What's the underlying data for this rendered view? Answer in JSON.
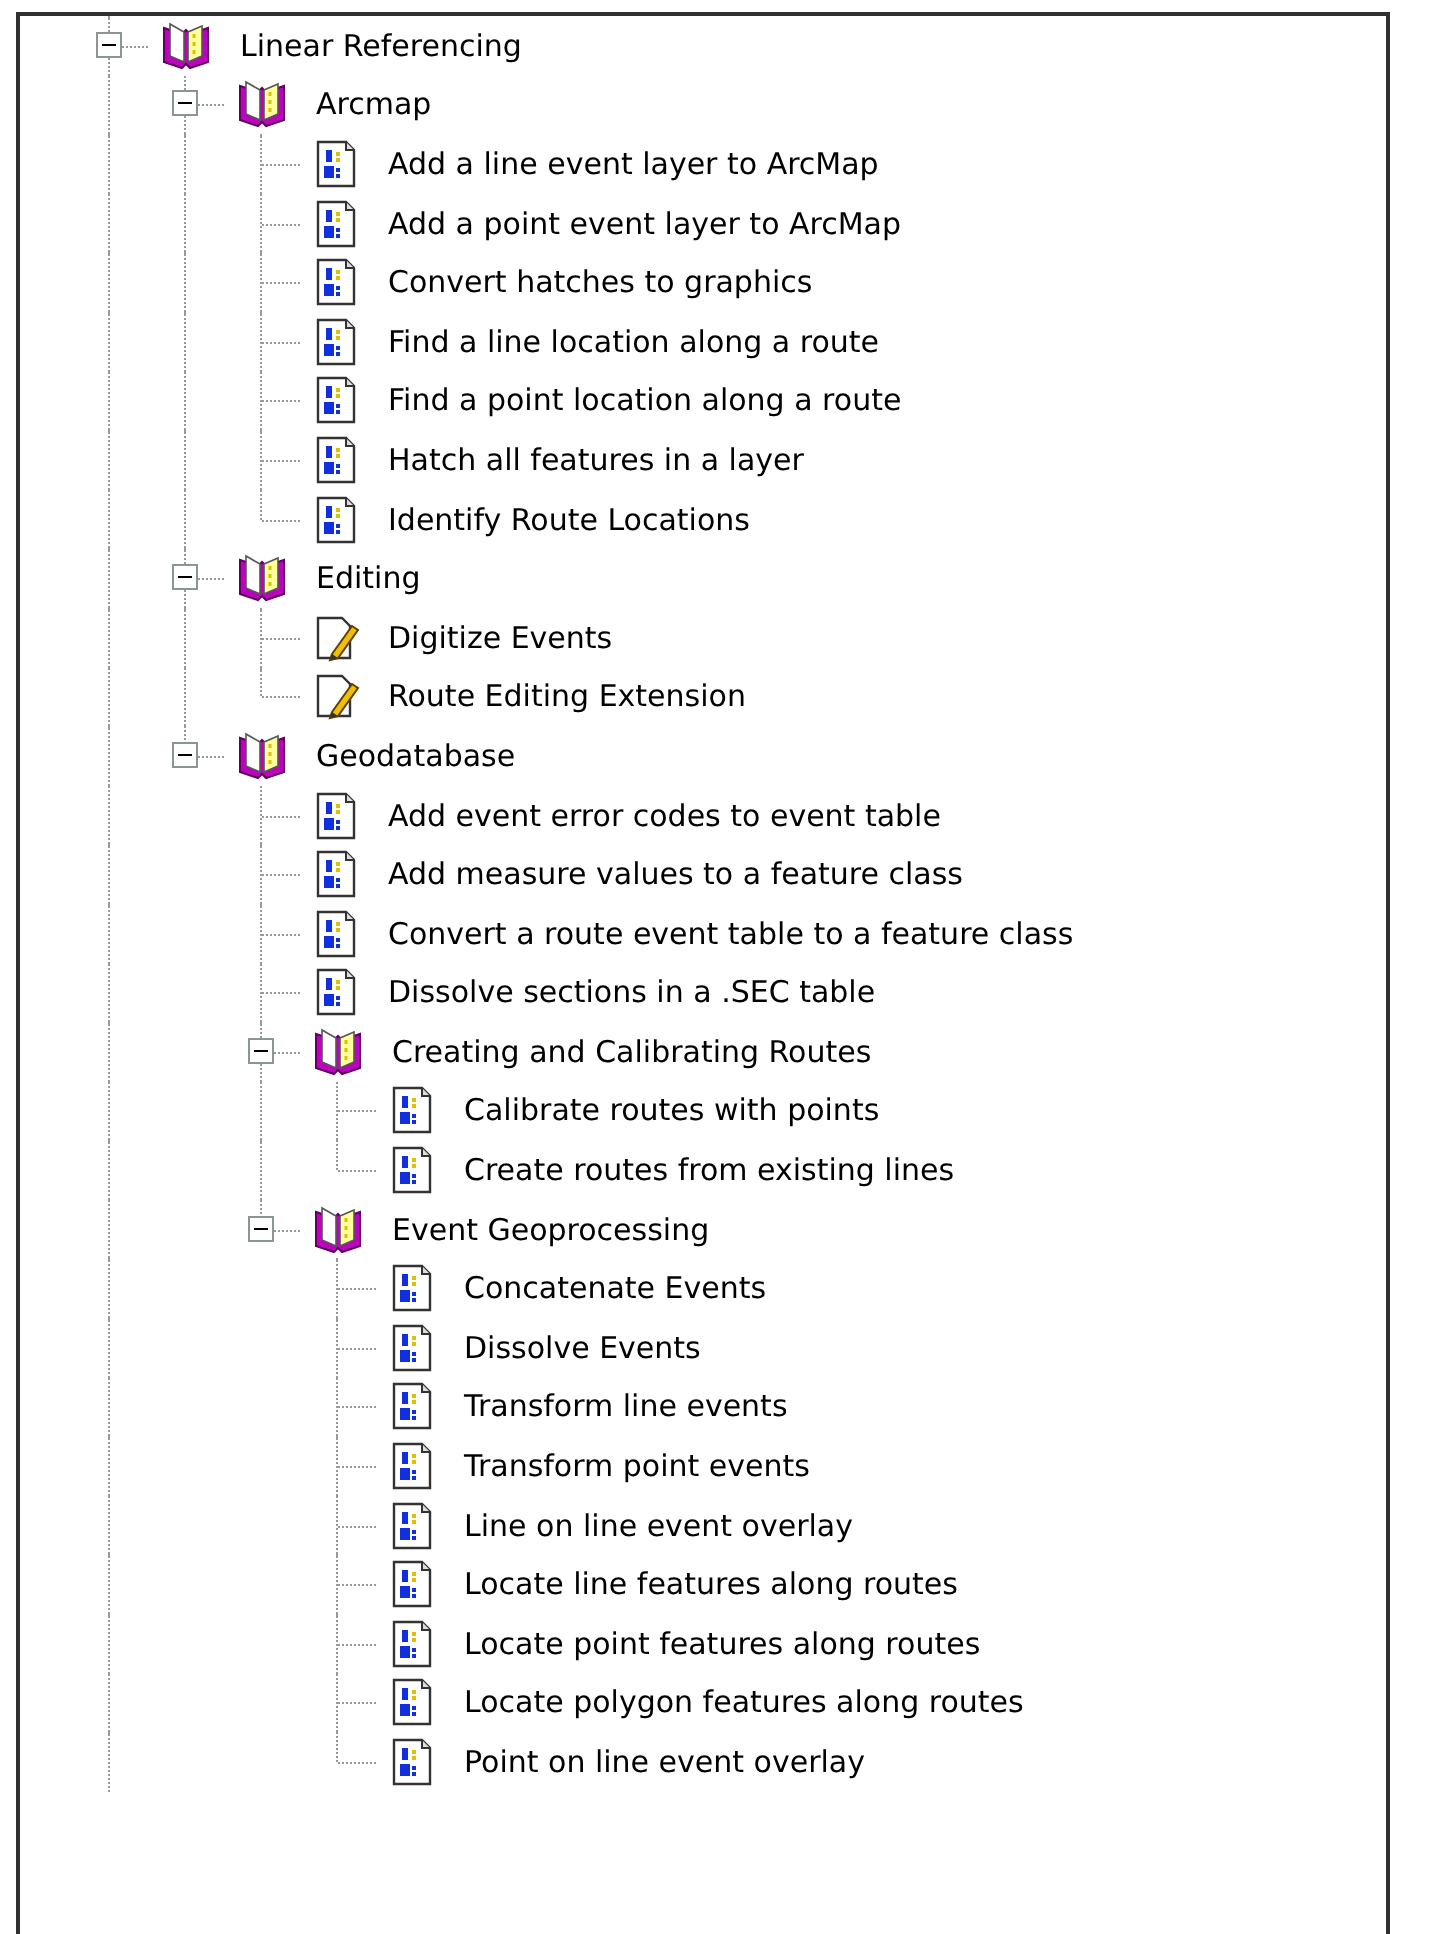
{
  "tree": [
    {
      "label": "Linear Referencing",
      "kind": "book",
      "expanded": true,
      "children": [
        {
          "label": "Arcmap",
          "kind": "book",
          "expanded": true,
          "children": [
            {
              "label": "Add a line event layer to ArcMap",
              "kind": "topic"
            },
            {
              "label": "Add a point event layer to ArcMap",
              "kind": "topic"
            },
            {
              "label": "Convert hatches to graphics",
              "kind": "topic"
            },
            {
              "label": "Find a line location along a route",
              "kind": "topic"
            },
            {
              "label": "Find a point location along a route",
              "kind": "topic"
            },
            {
              "label": "Hatch all features in a layer",
              "kind": "topic"
            },
            {
              "label": "Identify Route Locations",
              "kind": "topic"
            }
          ]
        },
        {
          "label": "Editing",
          "kind": "book",
          "expanded": true,
          "children": [
            {
              "label": "Digitize Events",
              "kind": "tool"
            },
            {
              "label": "Route Editing Extension",
              "kind": "tool"
            }
          ]
        },
        {
          "label": "Geodatabase",
          "kind": "book",
          "expanded": true,
          "children": [
            {
              "label": "Add event error codes to event table",
              "kind": "topic"
            },
            {
              "label": "Add measure values to a feature class",
              "kind": "topic"
            },
            {
              "label": "Convert a route event table to a feature class",
              "kind": "topic"
            },
            {
              "label": "Dissolve sections in a .SEC table",
              "kind": "topic"
            },
            {
              "label": "Creating and Calibrating Routes",
              "kind": "book",
              "expanded": true,
              "children": [
                {
                  "label": "Calibrate routes with points",
                  "kind": "topic"
                },
                {
                  "label": "Create routes from existing lines",
                  "kind": "topic"
                }
              ]
            },
            {
              "label": "Event Geoprocessing",
              "kind": "book",
              "expanded": true,
              "children": [
                {
                  "label": "Concatenate Events",
                  "kind": "topic"
                },
                {
                  "label": "Dissolve Events",
                  "kind": "topic"
                },
                {
                  "label": "Transform line events",
                  "kind": "topic"
                },
                {
                  "label": "Transform point events",
                  "kind": "topic"
                },
                {
                  "label": "Line on line event overlay",
                  "kind": "topic"
                },
                {
                  "label": "Locate line features along routes",
                  "kind": "topic"
                },
                {
                  "label": "Locate point features along routes",
                  "kind": "topic"
                },
                {
                  "label": "Locate polygon features along routes",
                  "kind": "topic"
                },
                {
                  "label": "Point on line event overlay",
                  "kind": "topic"
                }
              ]
            }
          ]
        }
      ]
    }
  ]
}
